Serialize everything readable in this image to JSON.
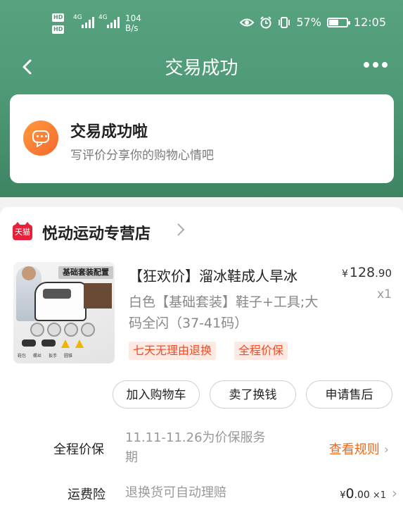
{
  "status_bar": {
    "hd1": "HD",
    "hd2": "HD",
    "signal1": "4G",
    "signal2": "4G",
    "net_speed_value": "104",
    "net_speed_unit": "B/s",
    "battery_percent": "57%",
    "battery_level": 0.57,
    "time": "12:05"
  },
  "nav": {
    "back_icon": "chevron-left-icon",
    "title": "交易成功",
    "more_icon": "more-dots-icon"
  },
  "success": {
    "title": "交易成功啦",
    "subtitle": "写评价分享你的购物心情吧"
  },
  "shop": {
    "badge": "天猫",
    "name": "悦动运动专营店"
  },
  "product": {
    "image_header": "基础套装配置",
    "image_labels": [
      "鞋包",
      "螺丝",
      "扳手",
      "圆锥"
    ],
    "title": "【狂欢价】溜冰鞋成人旱冰",
    "price_symbol": "¥",
    "price_int": "128",
    "price_dec": ".90",
    "quantity": "x1",
    "sku": "白色【基础套装】鞋子+工具;大码全闪（37-41码）",
    "tags": [
      "七天无理由退换",
      "全程价保"
    ]
  },
  "actions": {
    "add_cart": "加入购物车",
    "sell": "卖了换钱",
    "after_sales": "申请售后"
  },
  "price_protect": {
    "label": "全程价保",
    "text": "11.11-11.26为价保服务期",
    "link": "查看规则"
  },
  "shipping_insurance": {
    "label": "运费险",
    "text": "退换货可自动理赔",
    "price_symbol": "¥",
    "price_int": "0",
    "price_dec": ".00",
    "quantity": "×1"
  },
  "colors": {
    "header_green": "#4f9a77",
    "accent_orange": "#f04c24",
    "link_orange": "#e86a1c",
    "tmall_red": "#e8213b"
  }
}
